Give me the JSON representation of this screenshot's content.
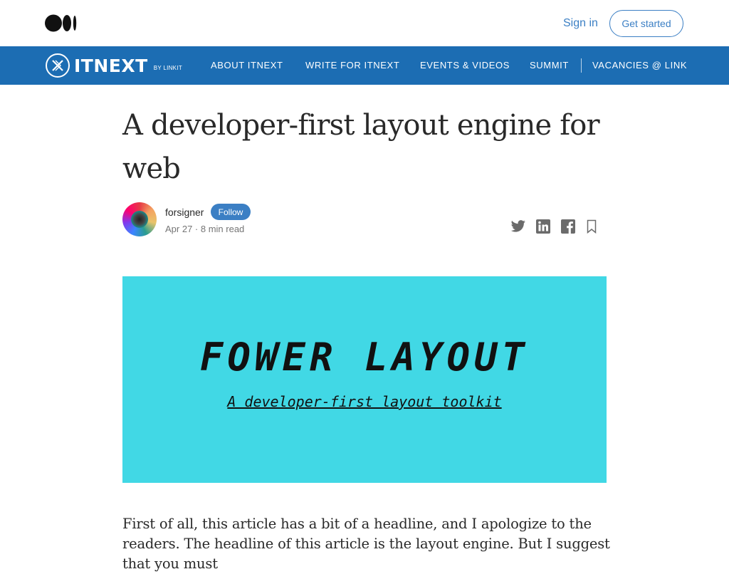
{
  "topbar": {
    "logo_icon": "medium-logo-icon",
    "signin_label": "Sign in",
    "get_started_label": "Get started"
  },
  "publication": {
    "name": "ITNEXT",
    "byline": "BY LINKIT",
    "nav": [
      {
        "label": "ABOUT ITNEXT"
      },
      {
        "label": "WRITE FOR ITNEXT"
      },
      {
        "label": "EVENTS & VIDEOS"
      },
      {
        "label": "SUMMIT"
      },
      {
        "label": "VACANCIES @ LINK"
      }
    ],
    "color": "#1c6db3"
  },
  "article": {
    "title": "A developer-first layout engine for web",
    "author": "forsigner",
    "follow_label": "Follow",
    "meta": "Apr 27 · 8 min read",
    "share_icons": [
      "twitter-icon",
      "linkedin-icon",
      "facebook-icon",
      "bookmark-icon"
    ],
    "hero": {
      "title": "FOWER LAYOUT",
      "subtitle": "A developer-first layout toolkit",
      "background": "#41d8e5"
    },
    "body": "First of all, this article has a bit of a headline, and I apologize to the readers. The headline of this article is the layout engine. But I suggest that you must"
  },
  "colors": {
    "accent": "#3b7fc4"
  }
}
